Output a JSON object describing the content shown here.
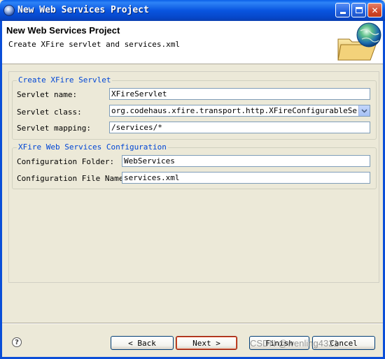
{
  "window": {
    "title": "New Web Services Project"
  },
  "header": {
    "title": "New Web Services Project",
    "subtitle": "Create XFire servlet and services.xml"
  },
  "servlet_group": {
    "title": "Create XFire Servlet",
    "name_label": "Servlet name:",
    "name_value": "XFireServlet",
    "class_label": "Servlet class:",
    "class_value": "org.codehaus.xfire.transport.http.XFireConfigurableServlet",
    "mapping_label": "Servlet mapping:",
    "mapping_value": "/services/*"
  },
  "config_group": {
    "title": "XFire Web Services Configuration",
    "folder_label": "Configuration Folder:",
    "folder_value": "WebServices",
    "file_label": "Configuration File Name:",
    "file_value": "services.xml"
  },
  "buttons": {
    "help": "?",
    "back": "< Back",
    "next": "Next >",
    "finish": "Finish",
    "cancel": "Cancel"
  },
  "watermark": "CSDN @wenling4321",
  "colors": {
    "titlebar": "#0955E0",
    "group_title": "#0046D5",
    "dialog_bg": "#ECE9D8"
  }
}
